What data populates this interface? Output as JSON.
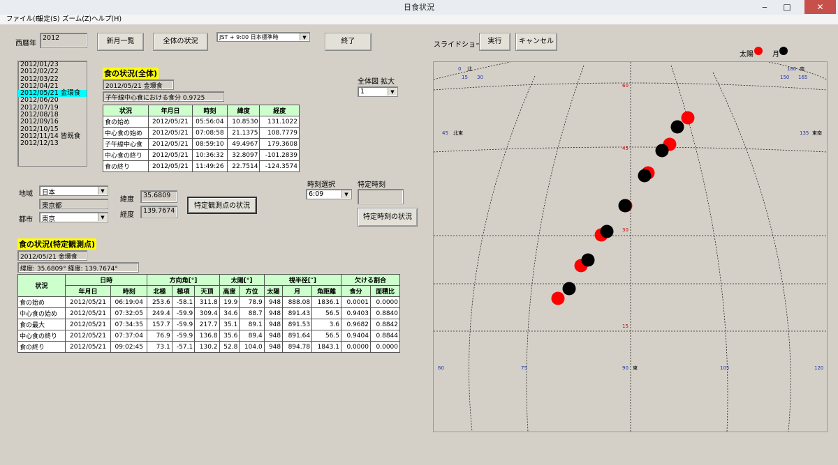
{
  "window": {
    "title": "日食状況"
  },
  "menu": [
    "ファイル(F)",
    "設定(S)",
    "ズーム(Z)",
    "ヘルプ(H)"
  ],
  "year": {
    "label": "西暦年",
    "value": "2012"
  },
  "buttons": {
    "new_moon_list": "新月一覧",
    "overall_status": "全体の状況",
    "exit": "終了",
    "observe_point_status": "特定観測点の状況",
    "specific_time_status": "特定時刻の状況",
    "run": "実行",
    "cancel": "キャンセル"
  },
  "timezone": {
    "value": "JST  + 9:00 日本標準時"
  },
  "slideshow": {
    "label": "スライドショー"
  },
  "legend": {
    "sun": "太陽",
    "moon": "月",
    "sun_color": "#ff0000",
    "moon_color": "#000000"
  },
  "eclipse_list": [
    {
      "text": "2012/01/23",
      "selected": false
    },
    {
      "text": "2012/02/22",
      "selected": false
    },
    {
      "text": "2012/03/22",
      "selected": false
    },
    {
      "text": "2012/04/21",
      "selected": false
    },
    {
      "text": "2012/05/21 金環食",
      "selected": true
    },
    {
      "text": "2012/06/20",
      "selected": false
    },
    {
      "text": "2012/07/19",
      "selected": false
    },
    {
      "text": "2012/08/18",
      "selected": false
    },
    {
      "text": "2012/09/16",
      "selected": false
    },
    {
      "text": "2012/10/15",
      "selected": false
    },
    {
      "text": "2012/11/14 皆既食",
      "selected": false
    },
    {
      "text": "2012/12/13",
      "selected": false
    }
  ],
  "overall": {
    "heading": "食の状況(全体)",
    "date_type": "2012/05/21 金環食",
    "meridian_mag": "子午線中心食における食分  0.9725",
    "headers": [
      "状況",
      "年月日",
      "時刻",
      "緯度",
      "経度"
    ],
    "rows": [
      [
        "食の始め",
        "2012/05/21",
        "05:56:04",
        "10.8530",
        "131.1022"
      ],
      [
        "中心食の始め",
        "2012/05/21",
        "07:08:58",
        "21.1375",
        "108.7779"
      ],
      [
        "子午線中心食",
        "2012/05/21",
        "08:59:10",
        "49.4967",
        "179.3608"
      ],
      [
        "中心食の終り",
        "2012/05/21",
        "10:36:32",
        "32.8097",
        "-101.2839"
      ],
      [
        "食の終り",
        "2012/05/21",
        "11:49:26",
        "22.7514",
        "-124.3574"
      ]
    ]
  },
  "zoom": {
    "label": "全体図 拡大",
    "value": "1"
  },
  "location": {
    "region_label": "地域",
    "region": "日本",
    "prefecture": "東京都",
    "city_label": "都市",
    "city": "東京",
    "lat_label": "緯度",
    "lat": "35.6809",
    "lon_label": "経度",
    "lon": "139.7674"
  },
  "time_select": {
    "label": "時刻選択",
    "value": "6:09",
    "specific_label": "特定時刻",
    "specific_value": ""
  },
  "observe": {
    "heading": "食の状況(特定観測点)",
    "date_type": "2012/05/21  金環食",
    "coords": "緯度: 35.6809°  経度: 139.7674°",
    "group_headers": [
      "状況",
      "日時",
      "方向角[°]",
      "太陽[°]",
      "視半径[″]",
      "欠ける割合"
    ],
    "sub_headers": [
      "年月日",
      "時刻",
      "北極",
      "極項",
      "天頂",
      "高度",
      "方位",
      "太陽",
      "月",
      "角距離",
      "食分",
      "面積比"
    ],
    "rows": [
      [
        "食の始め",
        "2012/05/21",
        "06:19:04",
        "253.6",
        "-58.1",
        "311.8",
        "19.9",
        "78.9",
        "948",
        "888.08",
        "1836.1",
        "0.0001",
        "0.0000"
      ],
      [
        "中心食の始め",
        "2012/05/21",
        "07:32:05",
        "249.4",
        "-59.9",
        "309.4",
        "34.6",
        "88.7",
        "948",
        "891.43",
        "56.5",
        "0.9403",
        "0.8840"
      ],
      [
        "食の最大",
        "2012/05/21",
        "07:34:35",
        "157.7",
        "-59.9",
        "217.7",
        "35.1",
        "89.1",
        "948",
        "891.53",
        "3.6",
        "0.9682",
        "0.8842"
      ],
      [
        "中心食の終り",
        "2012/05/21",
        "07:37:04",
        "76.9",
        "-59.9",
        "136.8",
        "35.6",
        "89.4",
        "948",
        "891.64",
        "56.5",
        "0.9404",
        "0.8844"
      ],
      [
        "食の終り",
        "2012/05/21",
        "09:02:45",
        "73.1",
        "-57.1",
        "130.2",
        "52.8",
        "104.0",
        "948",
        "894.78",
        "1843.1",
        "0.0000",
        "0.0000"
      ]
    ]
  },
  "sky_chart": {
    "azimuth_labels": [
      "60",
      "75",
      "90",
      "東",
      "105",
      "120"
    ],
    "altitude_labels": [
      "60",
      "45",
      "30",
      "15"
    ],
    "top_labels": [
      "0",
      "北",
      "15",
      "30",
      "150",
      "165",
      "180",
      "南"
    ],
    "side_labels": [
      "45",
      "北東",
      "135",
      "東南"
    ],
    "points": [
      {
        "az": 89.5,
        "alt": 43.5,
        "body": "sun"
      },
      {
        "az": 88.6,
        "alt": 42.2,
        "body": "moon"
      },
      {
        "az": 89.2,
        "alt": 40.5,
        "body": "sun"
      },
      {
        "az": 88.8,
        "alt": 39.6,
        "body": "moon"
      }
    ]
  }
}
